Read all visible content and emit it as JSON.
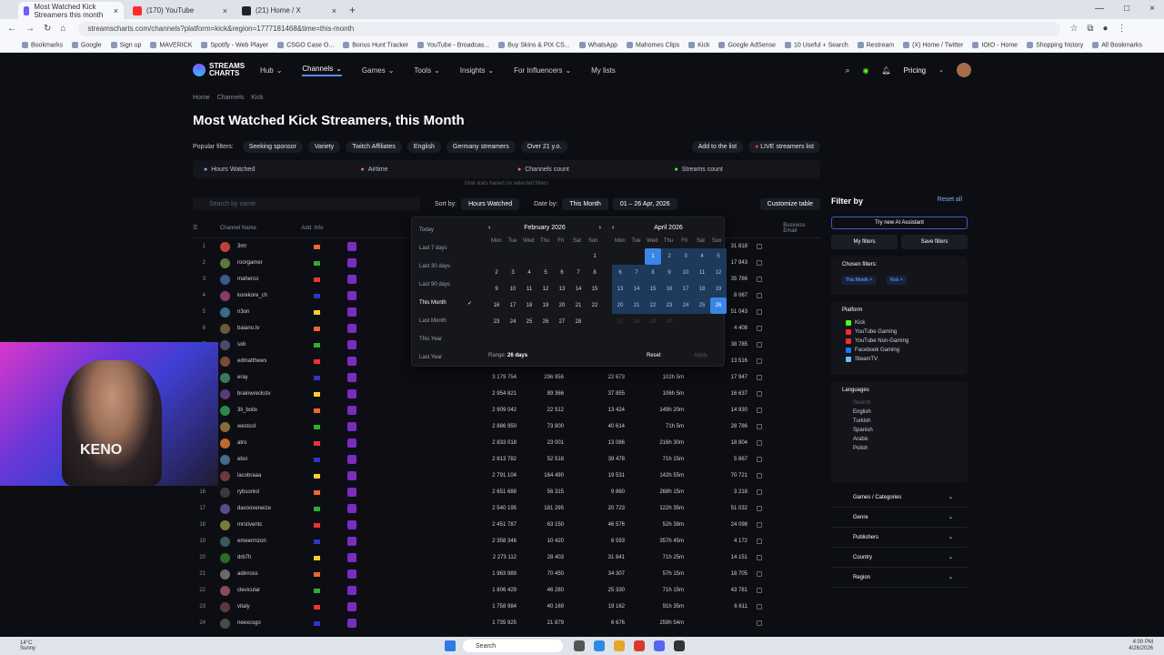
{
  "browser": {
    "tabs": [
      {
        "title": "Most Watched Kick Streamers this month",
        "color": "#6f5cff",
        "active": true
      },
      {
        "title": "(170) YouTube",
        "color": "#ff2b2b",
        "active": false
      },
      {
        "title": "(21) Home / X",
        "color": "#222222",
        "active": false
      }
    ],
    "url": "streamscharts.com/channels?platform=kick&region=1777181468&time=this-month",
    "bookmarks": [
      "Bookmarks",
      "Google",
      "Sign up",
      "MAVERICK",
      "Spotify - Web Player",
      "CSGO Case O...",
      "Bonus Hunt Tracker",
      "YouTube - Broadcas...",
      "Buy Skins & PIX CS...",
      "WhatsApp",
      "Mahomes Clips",
      "Kick",
      "Google AdSense",
      "10 Useful + Search",
      "Restream",
      "(X) Home / Twitter",
      "IOIO - Home",
      "Shopping history",
      "All Bookmarks"
    ]
  },
  "site": {
    "logo": "STREAMS CHARTS",
    "nav": [
      "Hub",
      "Channels",
      "Games",
      "Tools",
      "Insights",
      "For Influencers",
      "My lists"
    ],
    "pricing": "Pricing",
    "breadcrumb": [
      "Home",
      "Channels",
      "Kick"
    ],
    "title": "Most Watched Kick Streamers, this Month",
    "popular_label": "Popular filters:",
    "popular": [
      "Seeking sponsor",
      "Variety",
      "Twitch Affiliates",
      "English",
      "Germany streamers",
      "Over 21 y.o."
    ],
    "add_to_list": "Add to the list",
    "live_list": "LIVE streamers list",
    "stats": [
      "Hours Watched",
      "Airtime",
      "Channels count",
      "Streams count"
    ],
    "stats_note": "total stats based on selected filters",
    "search_placeholder": "Search by name",
    "sort_label": "Sort by:",
    "sort_value": "Hours Watched",
    "date_label": "Date by:",
    "date_value": "This Month",
    "date_range": "01 – 26 Apr, 2026",
    "customize": "Customize table",
    "headers": {
      "channel": "Channel Name",
      "info": "Add. Info",
      "email": "Business Email"
    }
  },
  "rows": [
    {
      "rank": "1",
      "name": "3mr",
      "hw": "",
      "pk": "",
      "avg": "",
      "ml": "",
      "fol": "31 818",
      "c": "#c04040"
    },
    {
      "rank": "2",
      "name": "roorgamer",
      "hw": "",
      "pk": "",
      "avg": "",
      "ml": "",
      "fol": "17 943",
      "c": "#5a7a3a"
    },
    {
      "rank": "3",
      "name": "maherco",
      "hw": "",
      "pk": "",
      "avg": "",
      "ml": "",
      "fol": "35 766",
      "c": "#3a5a8a"
    },
    {
      "rank": "4",
      "name": "korekore_ch",
      "hw": "",
      "pk": "",
      "avg": "",
      "ml": "",
      "fol": "8 067",
      "c": "#8a3a6a"
    },
    {
      "rank": "5",
      "name": "n3on",
      "hw": "",
      "pk": "",
      "avg": "",
      "ml": "",
      "fol": "51 043",
      "c": "#3a6a8a"
    },
    {
      "rank": "6",
      "name": "baiano.tv",
      "hw": "",
      "pk": "",
      "avg": "",
      "ml": "",
      "fol": "4 408",
      "c": "#6a5a3a"
    },
    {
      "rank": "7",
      "name": "sxb",
      "hw": "",
      "pk": "",
      "avg": "",
      "ml": "",
      "fol": "38 785",
      "c": "#4a4a6a"
    },
    {
      "rank": "8",
      "name": "edmatthews",
      "hw": "",
      "pk": "",
      "avg": "",
      "ml": "",
      "fol": "13 516",
      "c": "#7a4a3a"
    },
    {
      "rank": "9",
      "name": "eray",
      "hw": "3 179 754",
      "pk": "296 956",
      "avg": "22 673",
      "ml": "102h 5m",
      "fol": "17 947",
      "c": "#3a7a5a"
    },
    {
      "rank": "10",
      "name": "brainwreckstv",
      "hw": "2 954 821",
      "pk": "89 366",
      "avg": "37 855",
      "ml": "106h 5m",
      "fol": "16 637",
      "c": "#5a3a7a"
    },
    {
      "rank": "11",
      "name": "3li_boitx",
      "hw": "2 909 042",
      "pk": "22 512",
      "avg": "13 424",
      "ml": "149h 20m",
      "fol": "14 930",
      "c": "#2a8a4a"
    },
    {
      "rank": "12",
      "name": "westcol",
      "hw": "2 886 950",
      "pk": "73 800",
      "avg": "40 614",
      "ml": "71h 5m",
      "fol": "28 786",
      "c": "#8a6a3a"
    },
    {
      "rank": "13",
      "name": "atro",
      "hw": "2 833 018",
      "pk": "23 001",
      "avg": "13 086",
      "ml": "216h 30m",
      "fol": "18 804",
      "c": "#c06a2a"
    },
    {
      "rank": "14",
      "name": "ebsi",
      "hw": "2 813 782",
      "pk": "52 518",
      "avg": "39 478",
      "ml": "71h 15m",
      "fol": "5 867",
      "c": "#4a6a8a"
    },
    {
      "rank": "15",
      "name": "lacobraaa",
      "hw": "2 791 104",
      "pk": "164 490",
      "avg": "19 531",
      "ml": "142h 55m",
      "fol": "70 721",
      "c": "#6a3a3a"
    },
    {
      "rank": "16",
      "name": "rybsonlol",
      "hw": "2 651 688",
      "pk": "56 315",
      "avg": "9 860",
      "ml": "268h 15m",
      "fol": "3 218",
      "c": "#3a3a3a"
    },
    {
      "rank": "17",
      "name": "davooxeneize",
      "hw": "2 540 195",
      "pk": "181 295",
      "avg": "20 723",
      "ml": "122h 35m",
      "fol": "51 032",
      "c": "#5a4a8a"
    },
    {
      "rank": "18",
      "name": "mrstiventc",
      "hw": "2 451 787",
      "pk": "63 150",
      "avg": "46 576",
      "ml": "52h 38m",
      "fol": "24 098",
      "c": "#7a7a3a"
    },
    {
      "rank": "19",
      "name": "emeermzori",
      "hw": "2 358 346",
      "pk": "10 420",
      "avg": "6 593",
      "ml": "357h 45m",
      "fol": "4 172",
      "c": "#3a5a5a"
    },
    {
      "rank": "20",
      "name": "drb7h",
      "hw": "2 273 112",
      "pk": "28 403",
      "avg": "31 841",
      "ml": "71h 25m",
      "fol": "14 151",
      "c": "#2a6a2a"
    },
    {
      "rank": "21",
      "name": "adinross",
      "hw": "1 963 989",
      "pk": "70 450",
      "avg": "34 307",
      "ml": "57h 15m",
      "fol": "18 705",
      "c": "#6a6a6a"
    },
    {
      "rank": "22",
      "name": "clevicular",
      "hw": "1 806 429",
      "pk": "46 280",
      "avg": "25 330",
      "ml": "71h 15m",
      "fol": "43 781",
      "c": "#8a4a5a"
    },
    {
      "rank": "23",
      "name": "vitaly",
      "hw": "1 758 984",
      "pk": "40 169",
      "avg": "19 162",
      "ml": "91h 35m",
      "fol": "6 611",
      "c": "#5a3a3a"
    },
    {
      "rank": "24",
      "name": "neexcsgo",
      "hw": "1 735 925",
      "pk": "21 879",
      "avg": "6 676",
      "ml": "259h 54m",
      "fol": "",
      "c": "#4a4a4a"
    }
  ],
  "datepicker": {
    "presets": [
      "Today",
      "Last 7 days",
      "Last 30 days",
      "Last 90 days",
      "This Month",
      "Last Month",
      "This Year",
      "Last Year"
    ],
    "active_preset": "This Month",
    "month1": "February 2026",
    "month2": "April 2026",
    "dow": [
      "Mon",
      "Tue",
      "Wed",
      "Thu",
      "Fri",
      "Sat",
      "Sun"
    ],
    "range_label": "Range:",
    "range_value": "26 days",
    "reset": "Reset",
    "apply": "Apply"
  },
  "sidebar": {
    "title": "Filter by",
    "reset_all": "Reset all",
    "ai": "Try new AI Assistant",
    "my_filters": "My filters",
    "save_filters": "Save filters",
    "chosen": "Chosen filters:",
    "chosen_tags": [
      "This Month",
      "Kick"
    ],
    "platform_label": "Platform",
    "platforms": [
      {
        "name": "Kick",
        "color": "#53fc18"
      },
      {
        "name": "YouTube Gaming",
        "color": "#ff2b2b"
      },
      {
        "name": "YouTube Non-Gaming",
        "color": "#ff2b2b"
      },
      {
        "name": "Facebook Gaming",
        "color": "#1877f2"
      },
      {
        "name": "SteamTV",
        "color": "#66c0f4"
      }
    ],
    "languages_label": "Languages",
    "lang_search": "Search",
    "languages": [
      "English",
      "Turkish",
      "Spanish",
      "Arabic",
      "Polish"
    ],
    "collapsed": [
      "Games / Categories",
      "Genre",
      "Publishers",
      "Country",
      "Region"
    ]
  },
  "webcam": {
    "shirt_text": "KENO"
  },
  "taskbar": {
    "temp": "14°C",
    "weather": "Sunny",
    "search": "Search",
    "time": "4:00 PM",
    "date": "4/26/2026"
  }
}
